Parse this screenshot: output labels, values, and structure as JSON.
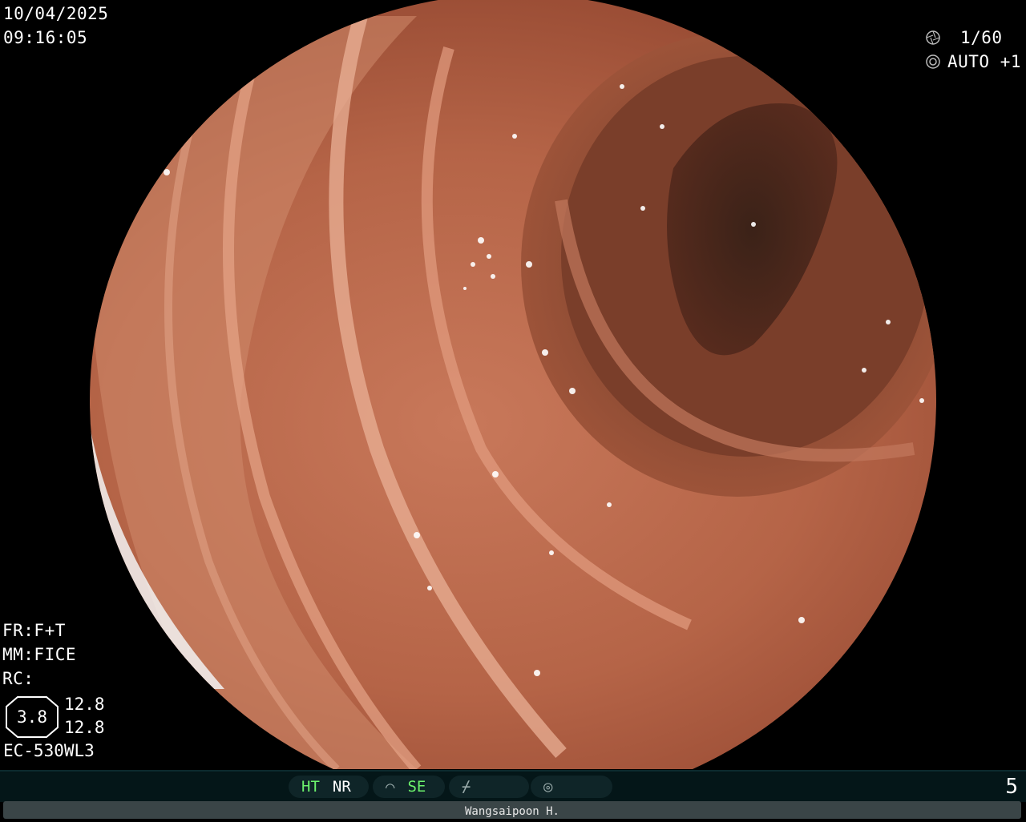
{
  "overlay": {
    "date": "10/04/2025",
    "time": "09:16:05",
    "shutter": "1/60",
    "auto": "AUTO +1",
    "shutter_icon": "aperture-icon",
    "auto_icon": "iris-icon",
    "fr": "FR:F+T",
    "mm": "MM:FICE",
    "rc": "RC:",
    "gauge_value": "3.8",
    "gauge_top": "12.8",
    "gauge_bottom": "12.8",
    "scope_model": "EC-530WL3"
  },
  "status_bar": {
    "ht": "HT",
    "nr": "NR",
    "se": "SE",
    "page": "5",
    "colors": {
      "active": "#6cf26c",
      "bar": "#041618"
    }
  },
  "footer": {
    "operator": "Wangsaipoon H."
  }
}
